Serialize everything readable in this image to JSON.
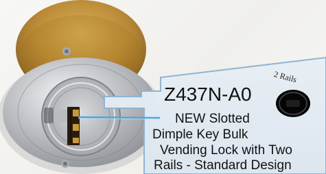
{
  "product": {
    "model": "Z437N-A0",
    "description_lines": [
      "NEW Slotted",
      "Dimple Key Bulk",
      "Vending Lock with Two",
      "Rails - Standard Design"
    ]
  },
  "inset": {
    "label": "2 Rails"
  },
  "colors": {
    "lock_face": "#b9bbc0",
    "brass_plug": "#b38a2a",
    "callout_line": "#4aa3df",
    "panel_border": "#8fb4d3",
    "text": "#111111"
  }
}
